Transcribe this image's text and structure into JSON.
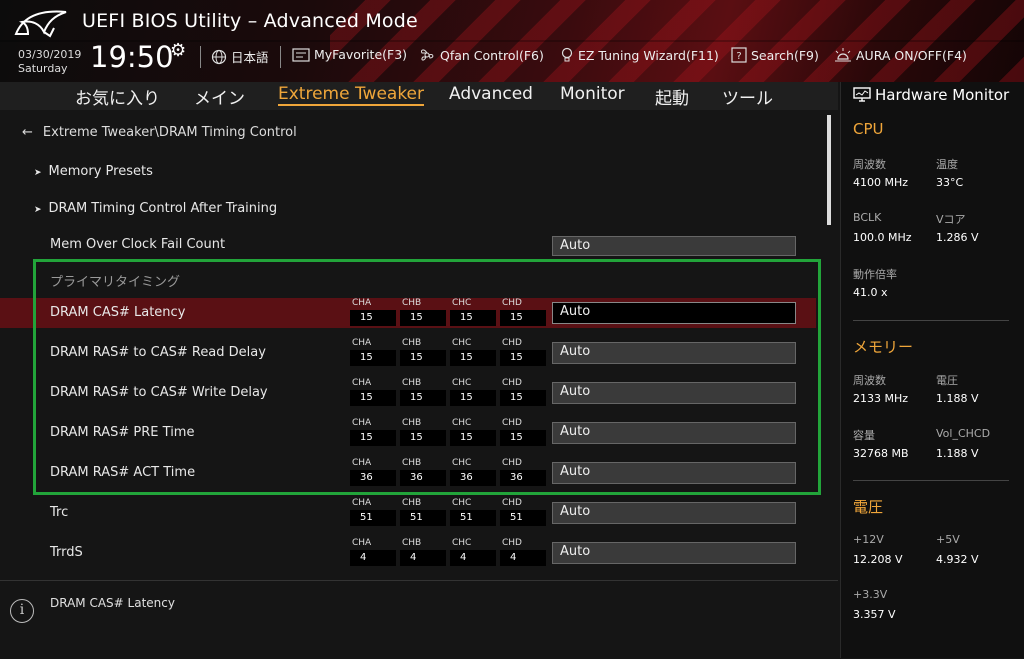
{
  "header": {
    "title": "UEFI BIOS Utility – Advanced Mode",
    "date": "03/30/2019",
    "day": "Saturday",
    "time": "19:50",
    "toolbar": {
      "language": "日本語",
      "myfavorite": "MyFavorite(F3)",
      "qfan": "Qfan Control(F6)",
      "ez_tuning": "EZ Tuning Wizard(F11)",
      "search": "Search(F9)",
      "aura": "AURA ON/OFF(F4)"
    }
  },
  "nav": {
    "tabs": [
      "お気に入り",
      "メイン",
      "Extreme Tweaker",
      "Advanced",
      "Monitor",
      "起動",
      "ツール"
    ],
    "active": "Extreme Tweaker"
  },
  "main": {
    "breadcrumb": "Extreme Tweaker\\DRAM Timing Control",
    "submenus": [
      "Memory Presets",
      "DRAM Timing Control After Training"
    ],
    "mem_fail": {
      "label": "Mem Over Clock Fail Count",
      "value": "Auto"
    },
    "section_title": "プライマリタイミング",
    "channel_labels": [
      "CHA",
      "CHB",
      "CHC",
      "CHD"
    ],
    "rows": [
      {
        "label": "DRAM CAS# Latency",
        "ch": [
          "15",
          "15",
          "15",
          "15"
        ],
        "value": "Auto"
      },
      {
        "label": "DRAM RAS# to CAS# Read Delay",
        "ch": [
          "15",
          "15",
          "15",
          "15"
        ],
        "value": "Auto"
      },
      {
        "label": "DRAM RAS# to CAS# Write Delay",
        "ch": [
          "15",
          "15",
          "15",
          "15"
        ],
        "value": "Auto"
      },
      {
        "label": "DRAM RAS# PRE Time",
        "ch": [
          "15",
          "15",
          "15",
          "15"
        ],
        "value": "Auto"
      },
      {
        "label": "DRAM RAS# ACT Time",
        "ch": [
          "36",
          "36",
          "36",
          "36"
        ],
        "value": "Auto"
      },
      {
        "label": "Trc",
        "ch": [
          "51",
          "51",
          "51",
          "51"
        ],
        "value": "Auto"
      },
      {
        "label": "TrrdS",
        "ch": [
          "4",
          "4",
          "4",
          "4"
        ],
        "value": "Auto"
      }
    ],
    "help_text": "DRAM CAS# Latency"
  },
  "hw": {
    "title": "Hardware Monitor",
    "cpu": {
      "title": "CPU",
      "freq_label": "周波数",
      "freq": "4100 MHz",
      "temp_label": "温度",
      "temp": "33°C",
      "bclk_label": "BCLK",
      "bclk": "100.0 MHz",
      "vcore_label": "Vコア",
      "vcore": "1.286 V",
      "ratio_label": "動作倍率",
      "ratio": "41.0 x"
    },
    "memory": {
      "title": "メモリー",
      "freq_label": "周波数",
      "freq": "2133 MHz",
      "volt_label": "電圧",
      "volt": "1.188 V",
      "cap_label": "容量",
      "cap": "32768 MB",
      "vol_chcd_label": "Vol_CHCD",
      "vol_chcd": "1.188 V"
    },
    "voltage": {
      "title": "電圧",
      "v12_label": "+12V",
      "v12": "12.208 V",
      "v5_label": "+5V",
      "v5": "4.932 V",
      "v33_label": "+3.3V",
      "v33": "3.357 V"
    }
  }
}
